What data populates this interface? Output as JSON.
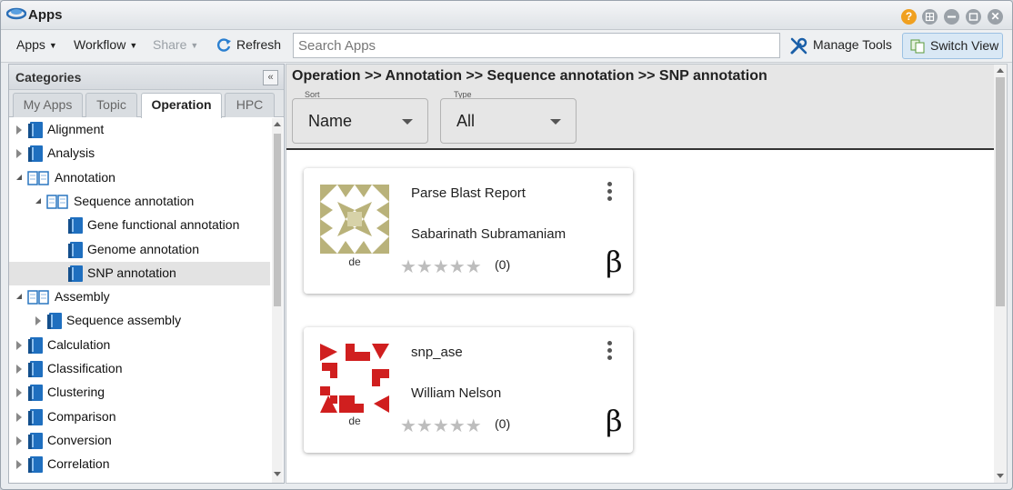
{
  "window": {
    "title": "Apps",
    "controls": [
      "help-icon",
      "grid-icon",
      "minimize-icon",
      "restore-icon",
      "close-icon"
    ],
    "help_glyph": "?",
    "close_glyph": "✕"
  },
  "toolbar": {
    "apps_label": "Apps",
    "workflow_label": "Workflow",
    "share_label": "Share",
    "refresh_label": "Refresh",
    "search_placeholder": "Search Apps",
    "search_value": "",
    "manage_tools_label": "Manage Tools",
    "switch_view_label": "Switch View",
    "caret": "▼"
  },
  "sidebar": {
    "title": "Categories",
    "collapse_glyph": "«",
    "tabs": [
      "My Apps",
      "Topic",
      "Operation",
      "HPC"
    ],
    "active_tab": "Operation",
    "tree": [
      {
        "label": "Alignment",
        "level": 0,
        "state": "closed",
        "icon": "book-icon"
      },
      {
        "label": "Analysis",
        "level": 0,
        "state": "closed",
        "icon": "book-icon"
      },
      {
        "label": "Annotation",
        "level": 0,
        "state": "open",
        "icon": "open-book-icon"
      },
      {
        "label": "Sequence annotation",
        "level": 1,
        "state": "open",
        "icon": "open-book-icon"
      },
      {
        "label": "Gene functional annotation",
        "level": 2,
        "state": "leaf",
        "icon": "book-icon"
      },
      {
        "label": "Genome annotation",
        "level": 2,
        "state": "leaf",
        "icon": "book-icon"
      },
      {
        "label": "SNP annotation",
        "level": 2,
        "state": "leaf",
        "icon": "book-icon",
        "selected": true
      },
      {
        "label": "Assembly",
        "level": 0,
        "state": "open",
        "icon": "open-book-icon"
      },
      {
        "label": "Sequence assembly",
        "level": 1,
        "state": "closed",
        "icon": "book-icon"
      },
      {
        "label": "Calculation",
        "level": 0,
        "state": "closed",
        "icon": "book-icon"
      },
      {
        "label": "Classification",
        "level": 0,
        "state": "closed",
        "icon": "book-icon"
      },
      {
        "label": "Clustering",
        "level": 0,
        "state": "closed",
        "icon": "book-icon"
      },
      {
        "label": "Comparison",
        "level": 0,
        "state": "closed",
        "icon": "book-icon"
      },
      {
        "label": "Conversion",
        "level": 0,
        "state": "closed",
        "icon": "book-icon"
      },
      {
        "label": "Correlation",
        "level": 0,
        "state": "closed",
        "icon": "book-icon"
      }
    ]
  },
  "main": {
    "breadcrumb": "Operation >> Annotation >> Sequence annotation >> SNP annotation",
    "sort": {
      "label": "Sort",
      "value": "Name"
    },
    "type": {
      "label": "Type",
      "value": "All"
    },
    "apps": [
      {
        "name": "Parse Blast Report",
        "author": "Sabarinath Subramaniam",
        "avatar_label": "de",
        "rating_count": "(0)",
        "badge": "β",
        "avatar_color": "#b9b27a"
      },
      {
        "name": "snp_ase",
        "author": "William Nelson",
        "avatar_label": "de",
        "rating_count": "(0)",
        "badge": "β",
        "avatar_color": "#d01f1f"
      }
    ],
    "stars": "★★★★★"
  },
  "colors": {
    "accent": "#1a6fc2",
    "selected_row": "#e3e3e3",
    "switch_view_bg": "#d9e8f5"
  }
}
